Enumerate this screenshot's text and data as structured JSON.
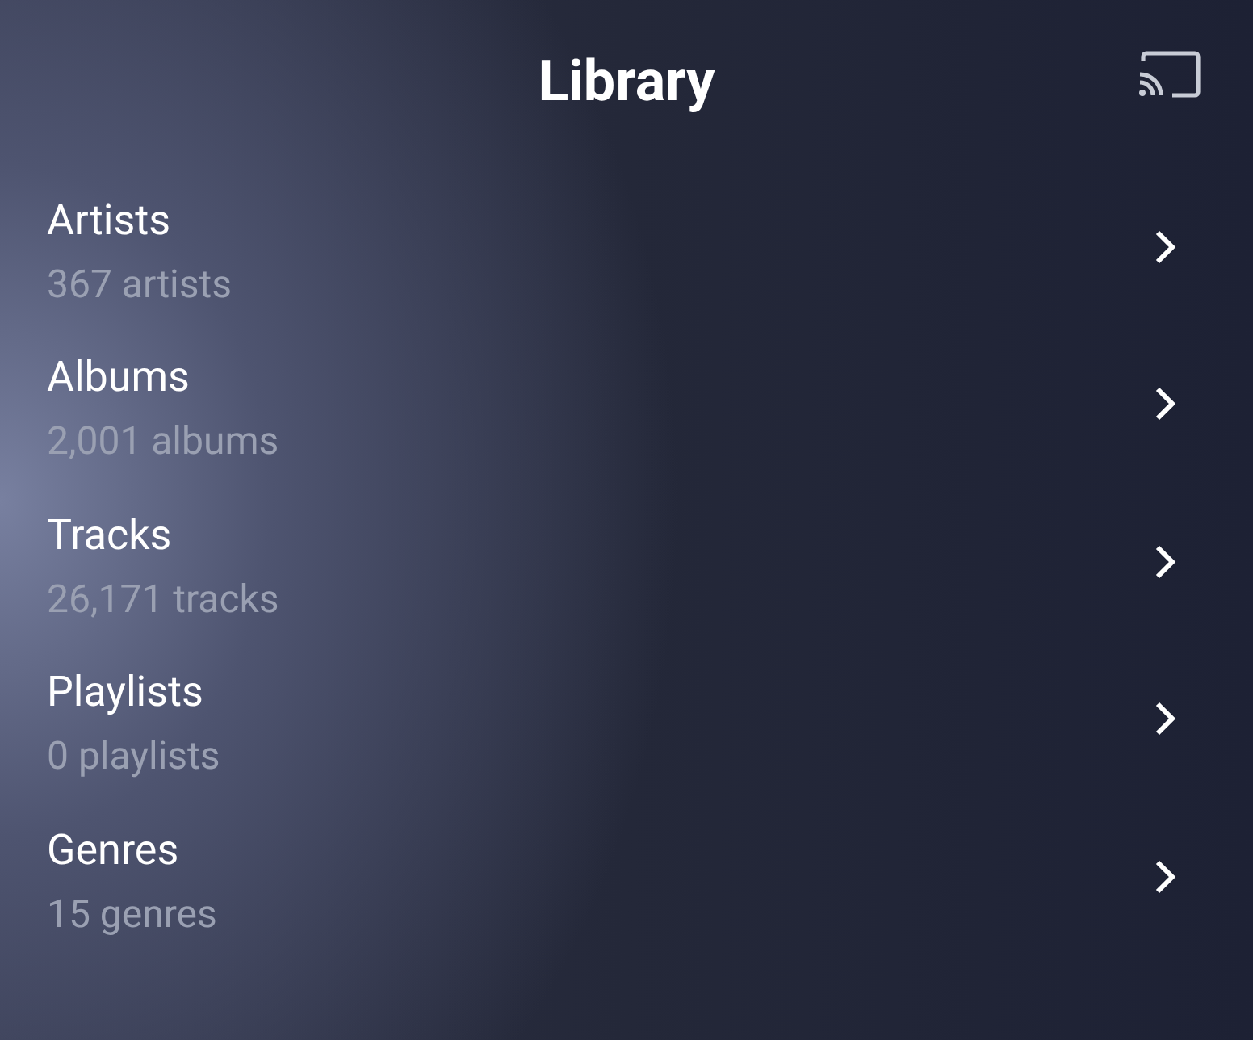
{
  "header": {
    "title": "Library"
  },
  "items": [
    {
      "title": "Artists",
      "subtitle": "367 artists"
    },
    {
      "title": "Albums",
      "subtitle": "2,001 albums"
    },
    {
      "title": "Tracks",
      "subtitle": "26,171 tracks"
    },
    {
      "title": "Playlists",
      "subtitle": "0 playlists"
    },
    {
      "title": "Genres",
      "subtitle": "15 genres"
    }
  ]
}
